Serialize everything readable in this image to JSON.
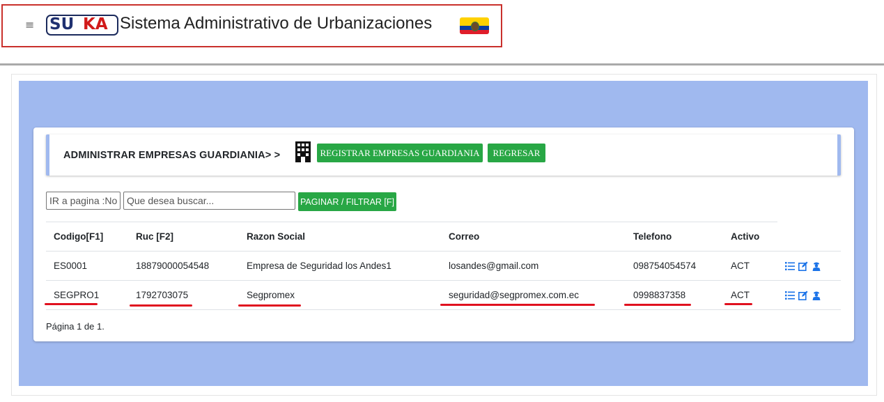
{
  "header": {
    "menu_icon": "hamburger-icon",
    "logo_text_1": "SU",
    "logo_text_2": "KA",
    "app_title": "Sistema Administrativo de Urbanizaciones",
    "flag_icon": "ecuador-flag-icon"
  },
  "colors": {
    "accent_green": "#28a745",
    "panel_blue": "#a0b9ef",
    "annotation_red": "#e0111f",
    "action_blue": "#1b73e8"
  },
  "panel": {
    "heading": "ADMINISTRAR EMPRESAS GUARDIANIA> >",
    "heading_icon": "building-icon",
    "register_button": "REGISTRAR EMPRESAS GUARDIANIA",
    "back_button": "REGRESAR"
  },
  "filters": {
    "page_placeholder": "IR a pagina :No",
    "search_placeholder": "Que desea buscar...",
    "filter_button": "PAGINAR / FILTRAR [F]"
  },
  "table": {
    "headers": [
      "Codigo[F1]",
      "Ruc [F2]",
      "Razon Social",
      "Correo",
      "Telefono",
      "Activo"
    ],
    "rows": [
      {
        "codigo": "ES0001",
        "ruc": "18879000054548",
        "razon": "Empresa de Seguridad los Andes1",
        "correo": "losandes@gmail.com",
        "telefono": "098754054574",
        "activo": "ACT",
        "actions": [
          "list-icon",
          "edit-icon",
          "guard-icon"
        ]
      },
      {
        "codigo": "SEGPRO1",
        "ruc": "1792703075",
        "razon": "Segpromex",
        "correo": "seguridad@segpromex.com.ec",
        "telefono": "0998837358",
        "activo": "ACT",
        "actions": [
          "list-icon",
          "edit-icon",
          "guard-icon"
        ]
      }
    ]
  },
  "pagination": "Página 1 de 1."
}
